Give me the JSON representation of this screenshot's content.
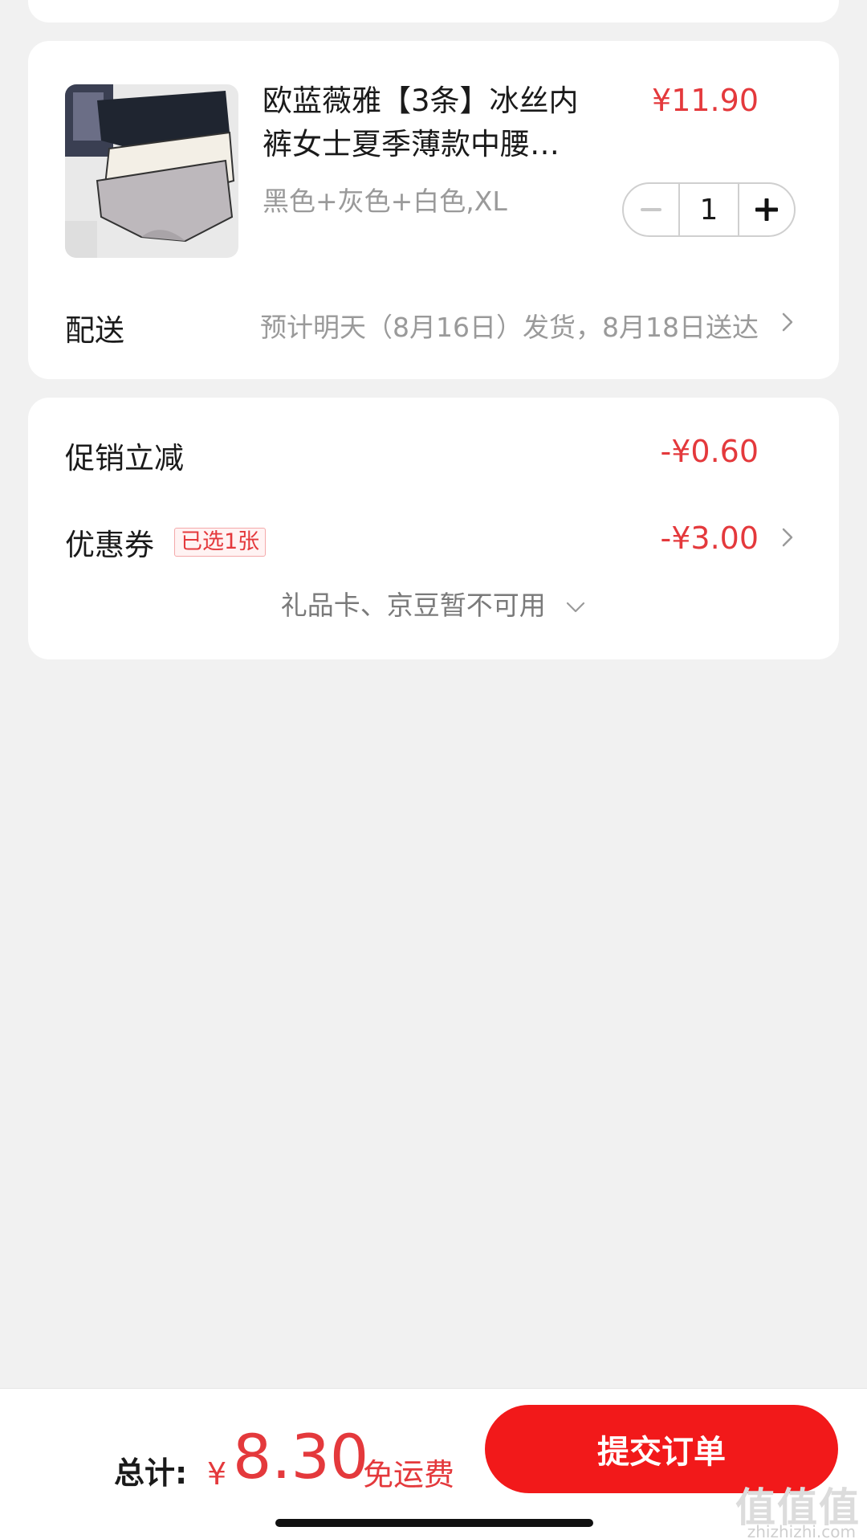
{
  "product": {
    "title": "欧蓝薇雅【3条】冰丝内裤女士夏季薄款中腰…",
    "price": "¥11.90",
    "spec": "黑色+灰色+白色,XL",
    "quantity": "1",
    "image_icon": "product-thumbnail-icon"
  },
  "delivery": {
    "label": "配送",
    "text": "预计明天（8月16日）发货，8月18日送达"
  },
  "discounts": {
    "promo_label": "促销立减",
    "promo_value": "-¥0.60",
    "coupon_label": "优惠券",
    "coupon_tag": "已选1张",
    "coupon_value": "-¥3.00",
    "giftcard_text": "礼品卡、京豆暂不可用"
  },
  "footer": {
    "total_label": "总计:",
    "currency": "¥",
    "total_amount": "8.30",
    "shipping": "免运费",
    "submit_label": "提交订单"
  },
  "watermark": {
    "logo": "值值值",
    "domain": "zhizhizhi.com"
  },
  "colors": {
    "accent": "#e4393c",
    "button": "#f2191a",
    "background": "#f1f1f1"
  }
}
